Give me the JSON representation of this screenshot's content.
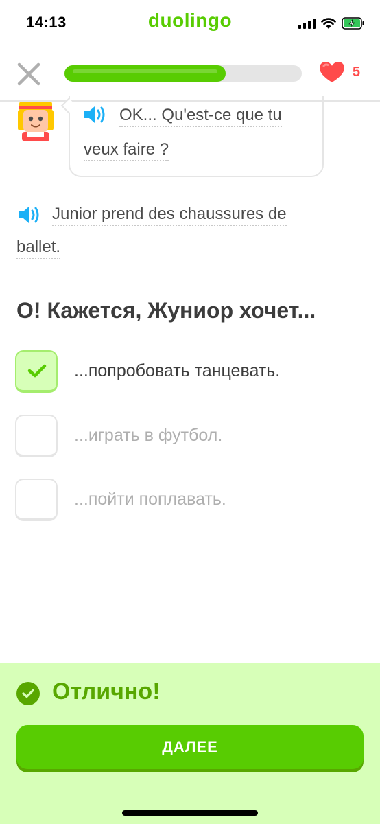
{
  "status_bar": {
    "time": "14:13",
    "brand": "duolingo"
  },
  "lesson": {
    "progress": 0.68,
    "hearts": "5"
  },
  "dialogue": {
    "speaker_line_1a": "OK... Qu'est-ce que tu",
    "speaker_line_1b": "veux faire ?",
    "narration_line_a": "Junior prend des chaussures de",
    "narration_line_b": "ballet."
  },
  "question": {
    "prompt": "О! Кажется, Жуниор хочет...",
    "options": [
      {
        "label": "...попробовать танцевать.",
        "selected": true
      },
      {
        "label": "...играть в футбол.",
        "selected": false
      },
      {
        "label": "...пойти поплавать.",
        "selected": false
      }
    ]
  },
  "feedback": {
    "title": "Отлично!",
    "continue_label": "ДАЛЕЕ"
  },
  "colors": {
    "brand_green": "#58cc02",
    "dark_green": "#58a700",
    "feedback_bg": "#d7ffb8",
    "heart_red": "#ff4b4b",
    "speaker_blue": "#1cb0f6"
  },
  "icons": {
    "close": "close-icon",
    "heart": "heart-icon",
    "speaker": "speaker-icon",
    "check": "check-icon"
  }
}
